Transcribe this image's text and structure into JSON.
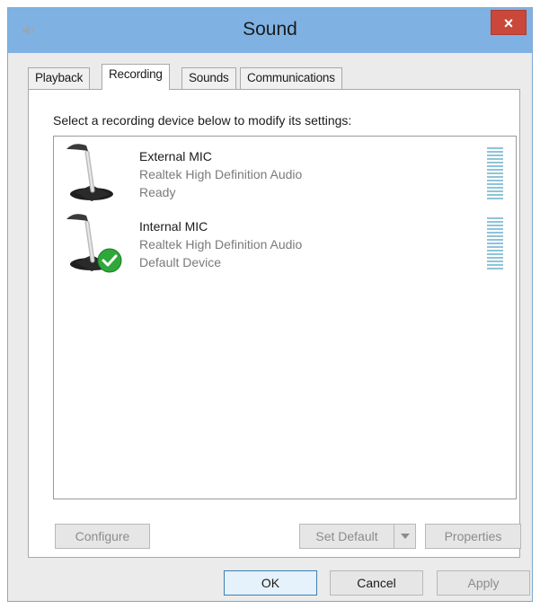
{
  "window": {
    "title": "Sound",
    "close_label": "×"
  },
  "tabs": [
    {
      "label": "Playback",
      "active": false
    },
    {
      "label": "Recording",
      "active": true
    },
    {
      "label": "Sounds",
      "active": false
    },
    {
      "label": "Communications",
      "active": false
    }
  ],
  "recording": {
    "instruction": "Select a recording device below to modify its settings:",
    "devices": [
      {
        "name": "External MIC",
        "driver": "Realtek High Definition Audio",
        "status": "Ready",
        "default": false
      },
      {
        "name": "Internal MIC",
        "driver": "Realtek High Definition Audio",
        "status": "Default Device",
        "default": true
      }
    ],
    "buttons": {
      "configure": "Configure",
      "set_default": "Set Default",
      "properties": "Properties"
    }
  },
  "footer": {
    "ok": "OK",
    "cancel": "Cancel",
    "apply": "Apply"
  },
  "colors": {
    "titlebar": "#7fb2e3",
    "close": "#c9483a",
    "meter": "#8fc4d8",
    "default_check": "#2fa83a"
  },
  "icons": {
    "title": "speaker-icon",
    "device": "microphone-icon",
    "default": "checkmark-icon"
  }
}
